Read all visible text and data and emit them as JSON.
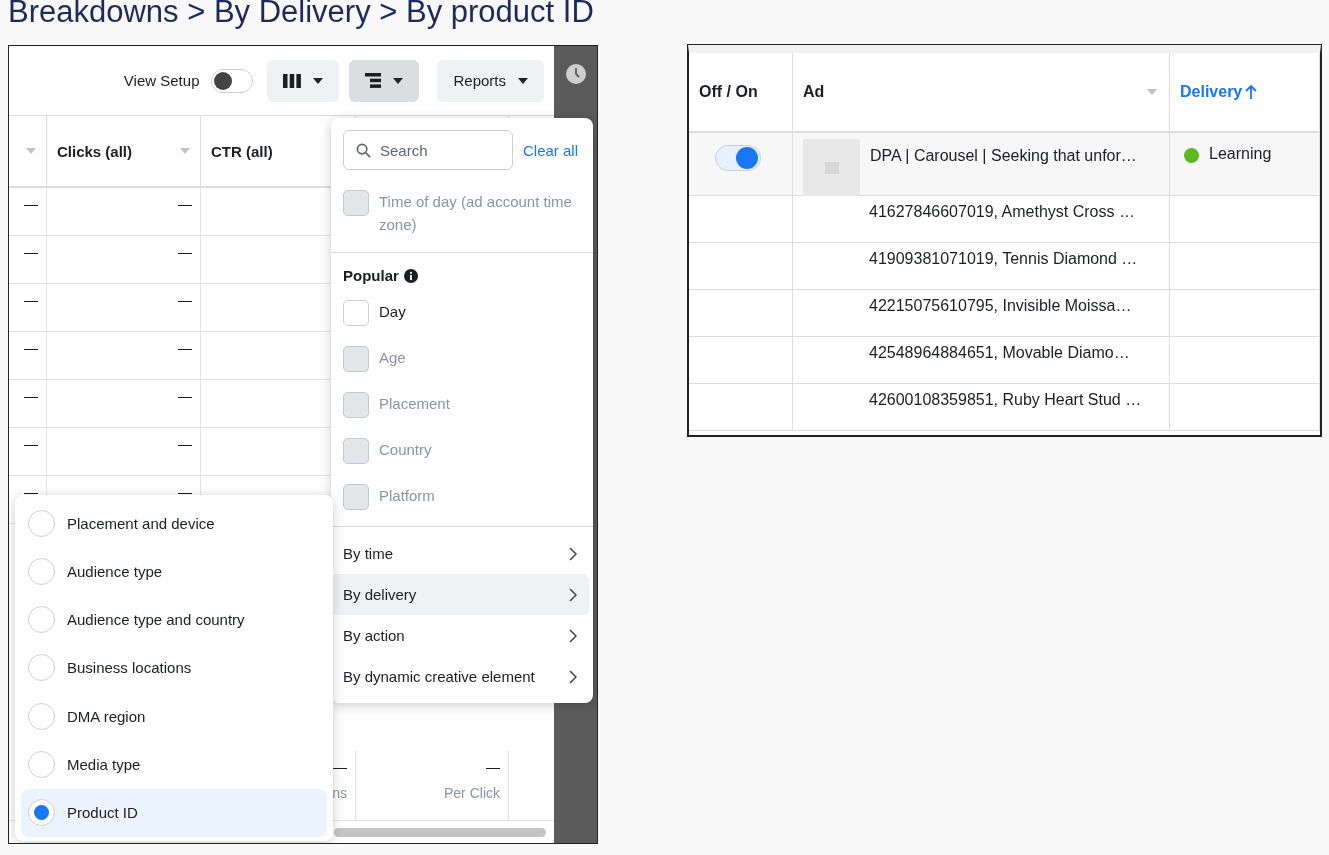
{
  "title": "Breakdowns > By Delivery > By product ID",
  "left_screenshot": {
    "toolbar": {
      "view_setup": {
        "label": "View Setup",
        "on": false
      },
      "buttons": [
        {
          "kind": "columns",
          "selected": false
        },
        {
          "kind": "breakdown",
          "selected": true
        },
        {
          "kind": "reports",
          "label": "Reports",
          "selected": false
        }
      ]
    },
    "table": {
      "columns": [
        {
          "menu": true
        },
        {
          "label": "Clicks (all)",
          "menu": true
        },
        {
          "label": "CTR (all)"
        }
      ],
      "rows": [
        {
          "cells": [
            {
              "value": "—"
            },
            {
              "value": "—"
            }
          ]
        },
        {
          "cells": [
            {
              "value": "—"
            },
            {
              "value": "—"
            }
          ]
        },
        {
          "cells": [
            {
              "value": "—"
            },
            {
              "value": "—"
            }
          ]
        },
        {
          "cells": [
            {
              "value": "—"
            },
            {
              "value": "—"
            }
          ]
        },
        {
          "cells": [
            {
              "value": "—"
            },
            {
              "value": "—"
            }
          ]
        },
        {
          "cells": [
            {
              "value": "—"
            },
            {
              "value": "—"
            }
          ]
        },
        {
          "cells": [
            {
              "value": "—"
            },
            {
              "value": "—"
            }
          ]
        }
      ],
      "footer_row": {
        "cells": [
          {},
          {},
          {
            "value": "—",
            "sub": "ns"
          },
          {
            "value": "—",
            "sub": "Per Click"
          }
        ]
      }
    },
    "breakdown_menu": {
      "search": {
        "placeholder": "Search"
      },
      "clear_all": "Clear all",
      "items": [
        {
          "label": "Time of day (ad account time zone)",
          "checked": false,
          "disabled": true
        }
      ],
      "popular": {
        "title": "Popular",
        "items": [
          {
            "label": "Day",
            "checked": false,
            "disabled": false
          },
          {
            "label": "Age",
            "checked": false,
            "disabled": true
          },
          {
            "label": "Placement",
            "checked": false,
            "disabled": true
          },
          {
            "label": "Country",
            "checked": false,
            "disabled": true
          },
          {
            "label": "Platform",
            "checked": false,
            "disabled": true
          }
        ]
      },
      "groups": [
        {
          "label": "By time",
          "selected": false
        },
        {
          "label": "By delivery",
          "selected": true
        },
        {
          "label": "By action",
          "selected": false
        },
        {
          "label": "By dynamic creative element",
          "selected": false
        }
      ]
    },
    "submenu": {
      "options": [
        {
          "label": "Placement and device",
          "selected": false
        },
        {
          "label": "Audience type",
          "selected": false
        },
        {
          "label": "Audience type and country",
          "selected": false
        },
        {
          "label": "Business locations",
          "selected": false
        },
        {
          "label": "DMA region",
          "selected": false
        },
        {
          "label": "Media type",
          "selected": false
        },
        {
          "label": "Product ID",
          "selected": true
        }
      ]
    }
  },
  "right_screenshot": {
    "columns": [
      {
        "label": "Off / On",
        "menu": false,
        "sorted": false
      },
      {
        "label": "Ad",
        "menu": true,
        "sorted": false
      },
      {
        "label": "Delivery",
        "menu": false,
        "sorted": true
      }
    ],
    "rows": [
      {
        "kind": "ad",
        "on": true,
        "ad": "DPA | Carousel | Seeking that unfor…",
        "delivery": "Learning",
        "color": "#5cb91f"
      },
      {
        "kind": "product",
        "ad": "41627846607019, Amethyst Cross …"
      },
      {
        "kind": "product",
        "ad": "41909381071019, Tennis Diamond …"
      },
      {
        "kind": "product",
        "ad": "42215075610795, Invisible Moissa…"
      },
      {
        "kind": "product",
        "ad": "42548964884651, Movable Diamo…"
      },
      {
        "kind": "product",
        "ad": "42600108359851, Ruby Heart Stud …"
      }
    ]
  }
}
